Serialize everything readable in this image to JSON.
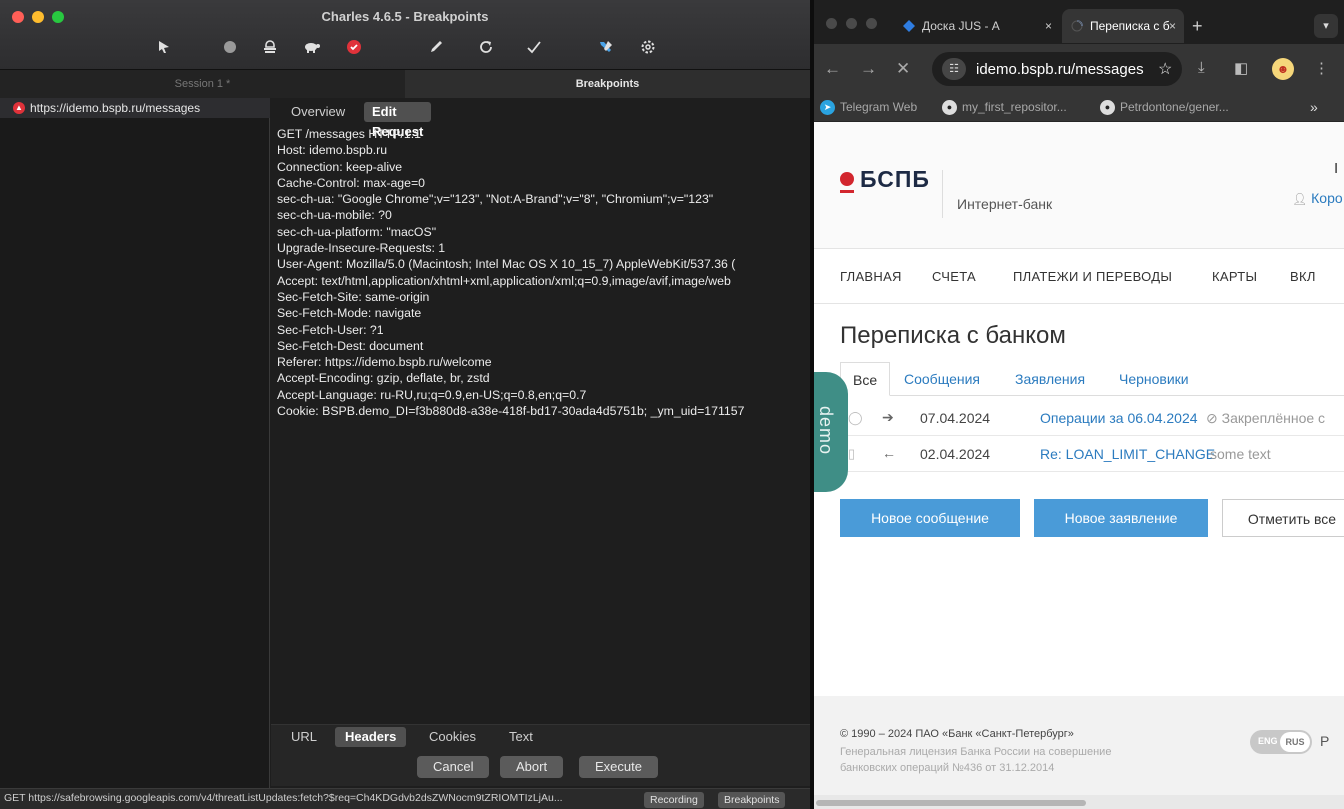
{
  "charles": {
    "title": "Charles 4.6.5 - Breakpoints",
    "toolbar_icons": [
      "pointer-icon",
      "record-circle-icon",
      "throttle-icon",
      "turtle-icon",
      "breakpoint-stop-icon",
      "pen-icon",
      "refresh-icon",
      "check-icon",
      "tools-icon",
      "settings-gear-icon"
    ],
    "session_tab": "Session 1 *",
    "breakpoints_tab": "Breakpoints",
    "tree_item": "https://idemo.bspb.ru/messages",
    "tabs": {
      "overview": "Overview",
      "edit_request": "Edit Request"
    },
    "request_lines": [
      "GET /messages HTTP/1.1",
      "Host: idemo.bspb.ru",
      "Connection: keep-alive",
      "Cache-Control: max-age=0",
      "sec-ch-ua: \"Google Chrome\";v=\"123\", \"Not:A-Brand\";v=\"8\", \"Chromium\";v=\"123\"",
      "sec-ch-ua-mobile: ?0",
      "sec-ch-ua-platform: \"macOS\"",
      "Upgrade-Insecure-Requests: 1",
      "User-Agent: Mozilla/5.0 (Macintosh; Intel Mac OS X 10_15_7) AppleWebKit/537.36 (",
      "Accept: text/html,application/xhtml+xml,application/xml;q=0.9,image/avif,image/web",
      "Sec-Fetch-Site: same-origin",
      "Sec-Fetch-Mode: navigate",
      "Sec-Fetch-User: ?1",
      "Sec-Fetch-Dest: document",
      "Referer: https://idemo.bspb.ru/welcome",
      "Accept-Encoding: gzip, deflate, br, zstd",
      "Accept-Language: ru-RU,ru;q=0.9,en-US;q=0.8,en;q=0.7",
      "Cookie: BSPB.demo_DI=f3b880d8-a38e-418f-bd17-30ada4d5751b; _ym_uid=171157"
    ],
    "bottom_tabs": {
      "url": "URL",
      "headers": "Headers",
      "cookies": "Cookies",
      "text": "Text"
    },
    "buttons": {
      "cancel": "Cancel",
      "abort": "Abort",
      "execute": "Execute"
    },
    "status_text": "GET https://safebrowsing.googleapis.com/v4/threatListUpdates:fetch?$req=Ch4KDGdvb2dsZWNocm9tZRIOMTIzLjAu...",
    "status_buttons": {
      "recording": "Recording",
      "breakpoints": "Breakpoints"
    }
  },
  "chrome": {
    "tabs": [
      {
        "title": "Доска JUS - А",
        "close": "×"
      },
      {
        "title": "Переписка с б",
        "close": "×"
      }
    ],
    "new_tab": "+",
    "url": "idemo.bspb.ru/messages",
    "bookmarks": [
      "Telegram Web",
      "my_first_repositor...",
      "Petrdontone/gener..."
    ],
    "bookmarks_more": "»"
  },
  "bank": {
    "logo": "БСПБ",
    "logo_sub": "Интернет-банк",
    "user_link": "Коро",
    "user_initial": "I",
    "nav": [
      "ГЛАВНАЯ",
      "СЧЕТА",
      "ПЛАТЕЖИ И ПЕРЕВОДЫ",
      "КАРТЫ",
      "ВКЛ"
    ],
    "page_title": "Переписка с банком",
    "filter_tabs": [
      "Все",
      "Сообщения",
      "Заявления",
      "Черновики"
    ],
    "messages": [
      {
        "date": "07.04.2024",
        "subject": "Операции за 06.04.2024",
        "extra": "Закреплённое с"
      },
      {
        "date": "02.04.2024",
        "subject": "Re: LOAN_LIMIT_CHANGE",
        "extra": "some text"
      }
    ],
    "demo_label": "demo",
    "buttons": {
      "new_message": "Новое сообщение",
      "new_request": "Новое заявление",
      "mark_all": "Отметить все"
    },
    "footer": {
      "copyright": "© 1990 – 2024 ПАО «Банк «Санкт-Петербург»",
      "license": "Генеральная лицензия Банка России на совершение банковских операций №436 от 31.12.2014",
      "lang_eng": "ENG",
      "lang_rus": "RUS",
      "lang_after": "Р"
    }
  }
}
